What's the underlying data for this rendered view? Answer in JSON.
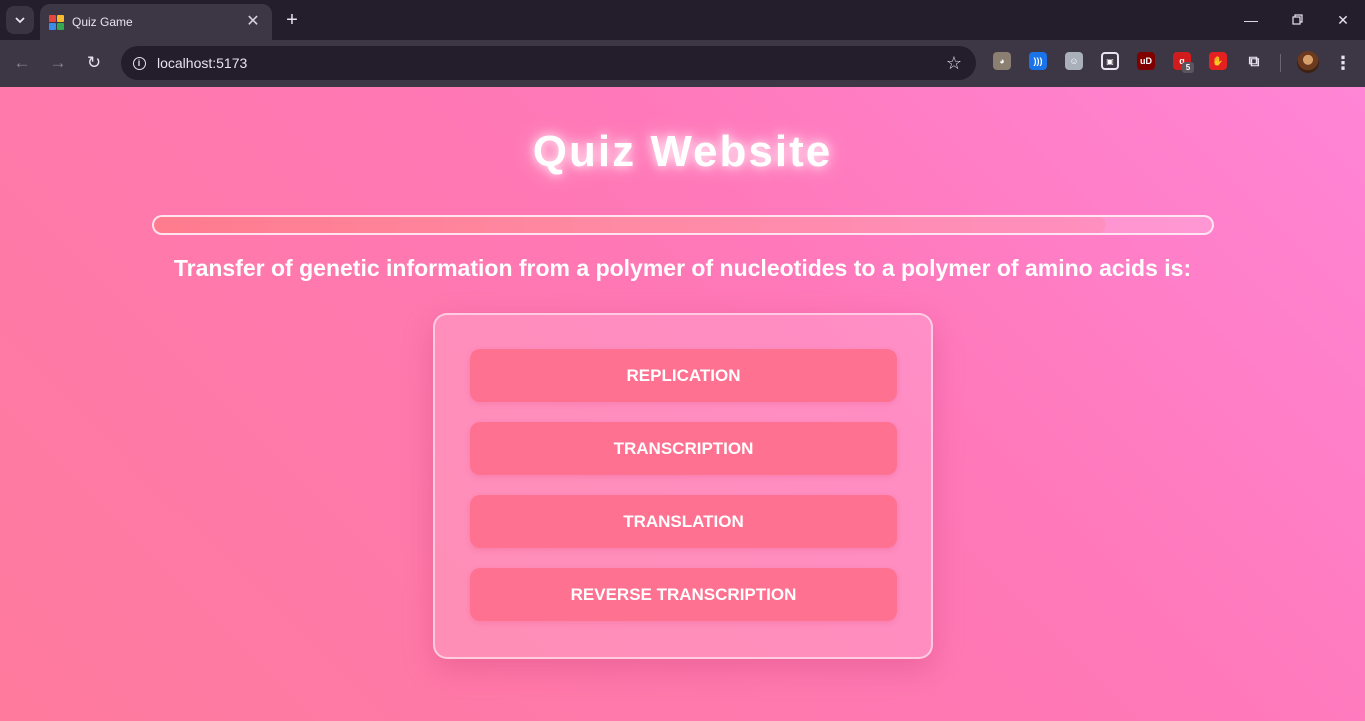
{
  "browser": {
    "tab": {
      "title": "Quiz Game",
      "favicon": "quiz-grid-icon",
      "favicon_colors": [
        "#e8453c",
        "#f9bb2d",
        "#3b8bea",
        "#34a853"
      ]
    },
    "new_tab_icon": "+",
    "url": "localhost:5173",
    "extensions": [
      {
        "name": "owl-extension-icon",
        "color": "#8a7f70",
        "glyph": "◕"
      },
      {
        "name": "wifi-extension-icon",
        "color": "#1a73e8",
        "glyph": ")))"
      },
      {
        "name": "ghost-extension-icon",
        "color": "#a9b0bb",
        "glyph": "☺"
      },
      {
        "name": "pip-extension-icon",
        "color": "#e8e3ee",
        "glyph": "▣"
      },
      {
        "name": "ublock-extension-icon",
        "color": "#800000",
        "glyph": "uD"
      },
      {
        "name": "red-a-extension-icon",
        "color": "#d01c1c",
        "glyph": "ɑ",
        "badge": "5"
      },
      {
        "name": "hand-stop-extension-icon",
        "color": "#e52020",
        "glyph": "✋"
      }
    ]
  },
  "page": {
    "title": "Quiz Website",
    "progress": 0.9,
    "question": "Transfer of genetic information from a polymer of nucleotides to a polymer of amino acids is:",
    "options": [
      "REPLICATION",
      "TRANSCRIPTION",
      "TRANSLATION",
      "REVERSE TRANSCRIPTION"
    ]
  }
}
